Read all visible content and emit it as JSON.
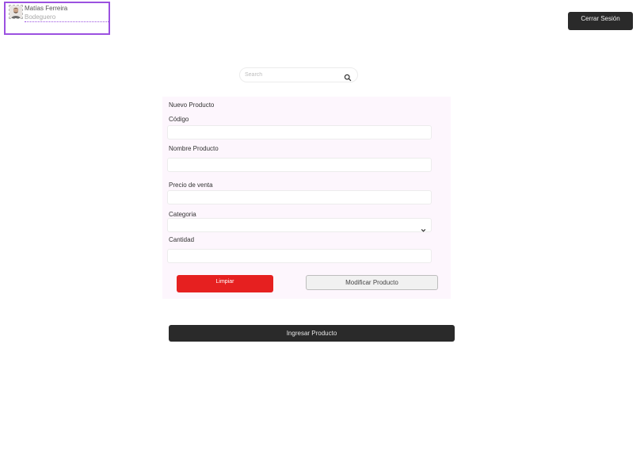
{
  "user": {
    "name": "Matías Ferreira",
    "role": "Bodeguero"
  },
  "header": {
    "logout_label": "Cerrar Sesión"
  },
  "search": {
    "placeholder": "Search",
    "value": ""
  },
  "form": {
    "title": "Nuevo Producto",
    "fields": [
      {
        "label": "Código",
        "value": ""
      },
      {
        "label": "Nombre Producto",
        "value": ""
      },
      {
        "label": "Precio de venta",
        "value": ""
      },
      {
        "label": "Categoria",
        "value": ""
      },
      {
        "label": "Cantidad",
        "value": ""
      }
    ],
    "clear_label": "Limpiar",
    "modify_label": "Modificar Producto"
  },
  "actions": {
    "submit_label": "Ingresar Producto"
  },
  "colors": {
    "accent_outline": "#9b51e0",
    "danger": "#e62020",
    "dark_button": "#2a2a2a",
    "form_background": "#fdf6fd"
  },
  "icons": {
    "search": "search-icon",
    "select": "chevron-down-icon",
    "avatar": "avatar"
  }
}
